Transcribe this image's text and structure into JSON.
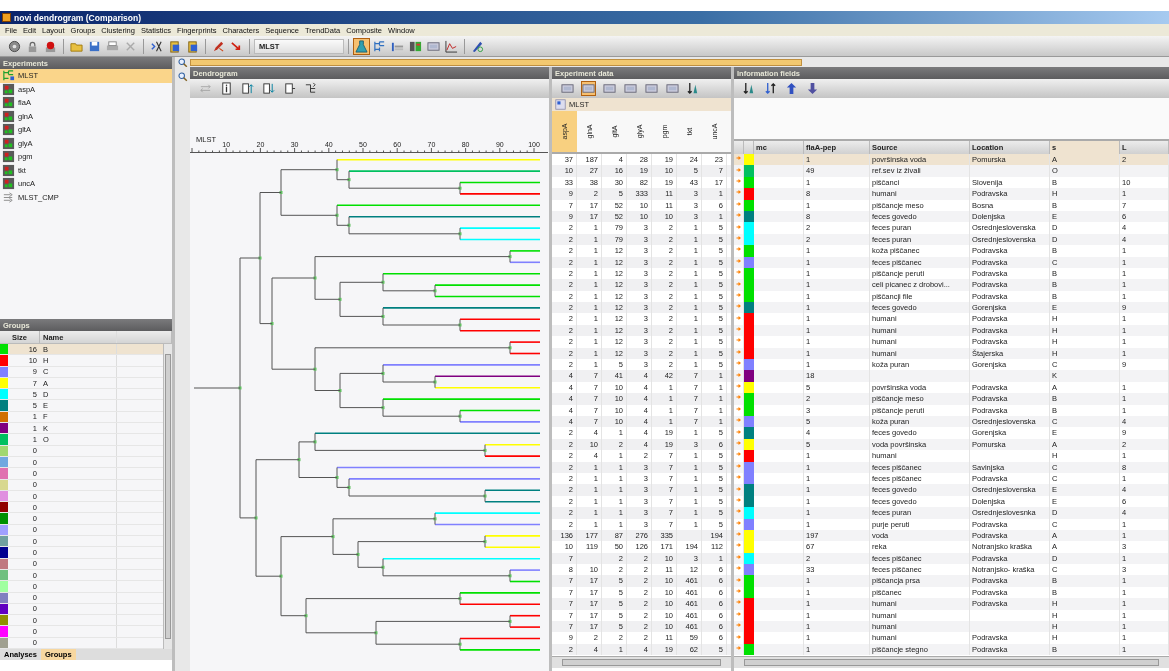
{
  "window": {
    "title": "novi dendrogram (Comparison)"
  },
  "menu": [
    "File",
    "Edit",
    "Layout",
    "Groups",
    "Clustering",
    "Statistics",
    "Fingerprints",
    "Characters",
    "Sequence",
    "TrendData",
    "Composite",
    "Window"
  ],
  "toolbar": {
    "left_groups": [
      [
        {
          "kind": "gear",
          "selected": false
        },
        {
          "kind": "lock",
          "selected": false
        },
        {
          "kind": "marker",
          "selected": false
        }
      ],
      [
        {
          "kind": "folder",
          "selected": false
        },
        {
          "kind": "save",
          "selected": false
        },
        {
          "kind": "printer",
          "selected": false
        },
        {
          "kind": "close",
          "selected": false
        }
      ],
      [
        {
          "kind": "scissors",
          "selected": false
        },
        {
          "kind": "clipboard",
          "selected": false
        },
        {
          "kind": "clipboard",
          "selected": false
        }
      ],
      [
        {
          "kind": "pencil",
          "selected": false
        },
        {
          "kind": "arrow",
          "selected": false
        }
      ]
    ],
    "combo": "MLST",
    "right_groups": [
      [
        {
          "kind": "flask",
          "selected": true
        },
        {
          "kind": "tree",
          "selected": false
        },
        {
          "kind": "bars",
          "selected": false
        },
        {
          "kind": "matrix",
          "selected": false
        },
        {
          "kind": "table",
          "selected": false
        },
        {
          "kind": "plot",
          "selected": false
        }
      ],
      [
        {
          "kind": "compass",
          "selected": false
        }
      ]
    ]
  },
  "experiments": {
    "title": "Experiments",
    "items": [
      {
        "label": "MLST",
        "kind": "cluster",
        "selected": true
      },
      {
        "label": "aspA",
        "kind": "character",
        "selected": false
      },
      {
        "label": "flaA",
        "kind": "character",
        "selected": false
      },
      {
        "label": "glnA",
        "kind": "character",
        "selected": false
      },
      {
        "label": "gltA",
        "kind": "character",
        "selected": false
      },
      {
        "label": "glyA",
        "kind": "character",
        "selected": false
      },
      {
        "label": "pgm",
        "kind": "character",
        "selected": false
      },
      {
        "label": "tkt",
        "kind": "character",
        "selected": false
      },
      {
        "label": "uncA",
        "kind": "character",
        "selected": false
      },
      {
        "label": "MLST_CMP",
        "kind": "composite",
        "selected": false
      }
    ]
  },
  "groups": {
    "title": "Groups",
    "columns": [
      "Size",
      "Name"
    ],
    "rows": [
      {
        "size": "16",
        "name": "B",
        "color": "#00e000",
        "selected": true
      },
      {
        "size": "10",
        "name": "H",
        "color": "#ff0000",
        "selected": false
      },
      {
        "size": "9",
        "name": "C",
        "color": "#8080ff",
        "selected": false
      },
      {
        "size": "7",
        "name": "A",
        "color": "#ffff00",
        "selected": false
      },
      {
        "size": "5",
        "name": "D",
        "color": "#00ffff",
        "selected": false
      },
      {
        "size": "5",
        "name": "E",
        "color": "#008080",
        "selected": false
      },
      {
        "size": "1",
        "name": "F",
        "color": "#d07000",
        "selected": false
      },
      {
        "size": "1",
        "name": "K",
        "color": "#800080",
        "selected": false
      },
      {
        "size": "1",
        "name": "O",
        "color": "#00c060",
        "selected": false
      },
      {
        "size": "0",
        "color": "#a0d870",
        "selected": false
      },
      {
        "size": "0",
        "color": "#70a8e0",
        "selected": false
      },
      {
        "size": "0",
        "color": "#e070b0",
        "selected": false
      },
      {
        "size": "0",
        "color": "#d8d890",
        "selected": false
      },
      {
        "size": "0",
        "color": "#e090e0",
        "selected": false
      },
      {
        "size": "0",
        "color": "#900000",
        "selected": false
      },
      {
        "size": "0",
        "color": "#009000",
        "selected": false
      },
      {
        "size": "0",
        "color": "#a0a0ff",
        "selected": false
      },
      {
        "size": "0",
        "color": "#70a0a0",
        "selected": false
      },
      {
        "size": "0",
        "color": "#000090",
        "selected": false
      },
      {
        "size": "0",
        "color": "#c07880",
        "selected": false
      },
      {
        "size": "0",
        "color": "#70c080",
        "selected": false
      },
      {
        "size": "0",
        "color": "#a0ffa0",
        "selected": false
      },
      {
        "size": "0",
        "color": "#8080c0",
        "selected": false
      },
      {
        "size": "0",
        "color": "#6000c0",
        "selected": false
      },
      {
        "size": "0",
        "color": "#909000",
        "selected": false
      },
      {
        "size": "0",
        "color": "#ff00ff",
        "selected": false
      },
      {
        "size": "0",
        "color": "#a0a090",
        "selected": false
      }
    ]
  },
  "bottom_tabs": [
    {
      "label": "Analyses",
      "selected": false
    },
    {
      "label": "Groups",
      "selected": true
    }
  ],
  "dendrogram": {
    "title": "Dendrogram",
    "toolbar": [
      {
        "kind": "swap",
        "disabled": true
      },
      {
        "kind": "info",
        "disabled": false
      },
      {
        "kind": "doc-up",
        "disabled": false
      },
      {
        "kind": "doc-down",
        "disabled": false
      },
      {
        "kind": "doc",
        "disabled": false
      },
      {
        "kind": "branch",
        "disabled": false
      }
    ],
    "axis_label": "MLST",
    "ticks": [
      "10",
      "20",
      "30",
      "40",
      "50",
      "60",
      "70",
      "80",
      "90",
      "100"
    ]
  },
  "experiment_data": {
    "title": "Experiment data",
    "toolbar": [
      {
        "kind": "table",
        "selected": false
      },
      {
        "kind": "table",
        "selected": true
      },
      {
        "kind": "table",
        "selected": false
      },
      {
        "kind": "table",
        "selected": false
      },
      {
        "kind": "table",
        "selected": false
      },
      {
        "kind": "table",
        "selected": false
      },
      {
        "kind": "sort",
        "selected": false
      }
    ],
    "experiment": "MLST",
    "columns": [
      {
        "label": "aspA",
        "selected": true
      },
      {
        "label": "glnA",
        "selected": false
      },
      {
        "label": "gltA",
        "selected": false
      },
      {
        "label": "glyA",
        "selected": false
      },
      {
        "label": "pgm",
        "selected": false
      },
      {
        "label": "tkt",
        "selected": false
      },
      {
        "label": "uncA",
        "selected": false
      }
    ],
    "rows": [
      [
        "37",
        "187",
        "4",
        "28",
        "19",
        "24",
        "23"
      ],
      [
        "10",
        "27",
        "16",
        "19",
        "10",
        "5",
        "7"
      ],
      [
        "33",
        "38",
        "30",
        "82",
        "19",
        "43",
        "17"
      ],
      [
        "9",
        "2",
        "5",
        "333",
        "11",
        "3",
        "1"
      ],
      [
        "7",
        "17",
        "52",
        "10",
        "11",
        "3",
        "6"
      ],
      [
        "9",
        "17",
        "52",
        "10",
        "10",
        "3",
        "1"
      ],
      [
        "2",
        "1",
        "79",
        "3",
        "2",
        "1",
        "5"
      ],
      [
        "2",
        "1",
        "79",
        "3",
        "2",
        "1",
        "5"
      ],
      [
        "2",
        "1",
        "12",
        "3",
        "2",
        "1",
        "5"
      ],
      [
        "2",
        "1",
        "12",
        "3",
        "2",
        "1",
        "5"
      ],
      [
        "2",
        "1",
        "12",
        "3",
        "2",
        "1",
        "5"
      ],
      [
        "2",
        "1",
        "12",
        "3",
        "2",
        "1",
        "5"
      ],
      [
        "2",
        "1",
        "12",
        "3",
        "2",
        "1",
        "5"
      ],
      [
        "2",
        "1",
        "12",
        "3",
        "2",
        "1",
        "5"
      ],
      [
        "2",
        "1",
        "12",
        "3",
        "2",
        "1",
        "5"
      ],
      [
        "2",
        "1",
        "12",
        "3",
        "2",
        "1",
        "5"
      ],
      [
        "2",
        "1",
        "12",
        "3",
        "2",
        "1",
        "5"
      ],
      [
        "2",
        "1",
        "12",
        "3",
        "2",
        "1",
        "5"
      ],
      [
        "2",
        "1",
        "5",
        "3",
        "2",
        "1",
        "5"
      ],
      [
        "4",
        "7",
        "41",
        "4",
        "42",
        "7",
        "1"
      ],
      [
        "4",
        "7",
        "10",
        "4",
        "1",
        "7",
        "1"
      ],
      [
        "4",
        "7",
        "10",
        "4",
        "1",
        "7",
        "1"
      ],
      [
        "4",
        "7",
        "10",
        "4",
        "1",
        "7",
        "1"
      ],
      [
        "4",
        "7",
        "10",
        "4",
        "1",
        "7",
        "1"
      ],
      [
        "2",
        "4",
        "1",
        "4",
        "19",
        "1",
        "5"
      ],
      [
        "2",
        "10",
        "2",
        "4",
        "19",
        "3",
        "6"
      ],
      [
        "2",
        "4",
        "1",
        "2",
        "7",
        "1",
        "5"
      ],
      [
        "2",
        "1",
        "1",
        "3",
        "7",
        "1",
        "5"
      ],
      [
        "2",
        "1",
        "1",
        "3",
        "7",
        "1",
        "5"
      ],
      [
        "2",
        "1",
        "1",
        "3",
        "7",
        "1",
        "5"
      ],
      [
        "2",
        "1",
        "1",
        "3",
        "7",
        "1",
        "5"
      ],
      [
        "2",
        "1",
        "1",
        "3",
        "7",
        "1",
        "5"
      ],
      [
        "2",
        "1",
        "1",
        "3",
        "7",
        "1",
        "5"
      ],
      [
        "136",
        "177",
        "87",
        "276",
        "335",
        null,
        "194"
      ],
      [
        "10",
        "119",
        "50",
        "126",
        "171",
        "194",
        "112"
      ],
      [
        "7",
        null,
        "2",
        "2",
        "10",
        "3",
        "1"
      ],
      [
        "8",
        "10",
        "2",
        "2",
        "11",
        "12",
        "6"
      ],
      [
        "7",
        "17",
        "5",
        "2",
        "10",
        "461",
        "6"
      ],
      [
        "7",
        "17",
        "5",
        "2",
        "10",
        "461",
        "6"
      ],
      [
        "7",
        "17",
        "5",
        "2",
        "10",
        "461",
        "6"
      ],
      [
        "7",
        "17",
        "5",
        "2",
        "10",
        "461",
        "6"
      ],
      [
        "7",
        "17",
        "5",
        "2",
        "10",
        "461",
        "6"
      ],
      [
        "9",
        "2",
        "2",
        "2",
        "11",
        "59",
        "6"
      ],
      [
        "2",
        "4",
        "1",
        "4",
        "19",
        "62",
        "5"
      ]
    ]
  },
  "information_fields": {
    "title": "Information fields",
    "toolbar": [
      {
        "kind": "sort"
      },
      {
        "kind": "sort2"
      },
      {
        "kind": "up"
      },
      {
        "kind": "down"
      }
    ],
    "columns": [
      {
        "label": "mc",
        "selected": false
      },
      {
        "label": "flaA-pep",
        "selected": false
      },
      {
        "label": "Source",
        "selected": false
      },
      {
        "label": "Location",
        "selected": false
      },
      {
        "label": "s",
        "selected": true
      },
      {
        "label": "L",
        "selected": false
      }
    ],
    "rows": [
      {
        "cells": [
          null,
          "1",
          "površinska voda",
          "Pomurska",
          "A",
          "2"
        ],
        "color": "#ffff00",
        "selected": true
      },
      {
        "cells": [
          null,
          "49",
          "ref.sev iz živali",
          null,
          "O",
          null
        ],
        "color": "#00c060",
        "selected": false
      },
      {
        "cells": [
          null,
          "1",
          "piščanci",
          "Slovenija",
          "B",
          "10"
        ],
        "color": "#00e000",
        "selected": false
      },
      {
        "cells": [
          null,
          "8",
          "humani",
          "Podravska",
          "H",
          "1"
        ],
        "color": "#ff0000",
        "selected": false
      },
      {
        "cells": [
          null,
          "1",
          "piščancje meso",
          "Bosna",
          "B",
          "7"
        ],
        "color": "#00e000",
        "selected": false
      },
      {
        "cells": [
          null,
          "8",
          "feces govedo",
          "Dolenjska",
          "E",
          "6"
        ],
        "color": "#008080",
        "selected": false
      },
      {
        "cells": [
          null,
          "2",
          "feces puran",
          "Osrednjeslovenska",
          "D",
          "4"
        ],
        "color": "#00ffff",
        "selected": false
      },
      {
        "cells": [
          null,
          "2",
          "feces puran",
          "Osrednjeslovenska",
          "D",
          "4"
        ],
        "color": "#00ffff",
        "selected": false
      },
      {
        "cells": [
          null,
          "1",
          "koža piščanec",
          "Podravska",
          "B",
          "1"
        ],
        "color": "#00e000",
        "selected": false
      },
      {
        "cells": [
          null,
          "1",
          "feces piščanec",
          "Podravska",
          "C",
          "1"
        ],
        "color": "#8080ff",
        "selected": false
      },
      {
        "cells": [
          null,
          "1",
          "piščancje peruti",
          "Podravska",
          "B",
          "1"
        ],
        "color": "#00e000",
        "selected": false
      },
      {
        "cells": [
          null,
          "1",
          "celi picanec z drobovi...",
          "Podravska",
          "B",
          "1"
        ],
        "color": "#00e000",
        "selected": false
      },
      {
        "cells": [
          null,
          "1",
          "piščancji file",
          "Podravska",
          "B",
          "1"
        ],
        "color": "#00e000",
        "selected": false
      },
      {
        "cells": [
          null,
          "1",
          "feces govedo",
          "Gorenjska",
          "E",
          "9"
        ],
        "color": "#008080",
        "selected": false
      },
      {
        "cells": [
          null,
          "1",
          "humani",
          "Podravska",
          "H",
          "1"
        ],
        "color": "#ff0000",
        "selected": false
      },
      {
        "cells": [
          null,
          "1",
          "humani",
          "Podravska",
          "H",
          "1"
        ],
        "color": "#ff0000",
        "selected": false
      },
      {
        "cells": [
          null,
          "1",
          "humani",
          "Podravska",
          "H",
          "1"
        ],
        "color": "#ff0000",
        "selected": false
      },
      {
        "cells": [
          null,
          "1",
          "humani",
          "Štajerska",
          "H",
          "1"
        ],
        "color": "#ff0000",
        "selected": false
      },
      {
        "cells": [
          null,
          "1",
          "koža puran",
          "Gorenjska",
          "C",
          "9"
        ],
        "color": "#8080ff",
        "selected": false
      },
      {
        "cells": [
          null,
          "18",
          null,
          null,
          "K",
          null
        ],
        "color": "#800080",
        "selected": false
      },
      {
        "cells": [
          null,
          "5",
          "površinska voda",
          "Podravska",
          "A",
          "1"
        ],
        "color": "#ffff00",
        "selected": false
      },
      {
        "cells": [
          null,
          "2",
          "piščancje meso",
          "Podravska",
          "B",
          "1"
        ],
        "color": "#00e000",
        "selected": false
      },
      {
        "cells": [
          null,
          "3",
          "piščancje peruti",
          "Podravska",
          "B",
          "1"
        ],
        "color": "#00e000",
        "selected": false
      },
      {
        "cells": [
          null,
          "5",
          "koža puran",
          "Osrednjeslovenska",
          "C",
          "4"
        ],
        "color": "#8080ff",
        "selected": false
      },
      {
        "cells": [
          null,
          "4",
          "feces govedo",
          "Gorenjska",
          "E",
          "9"
        ],
        "color": "#008080",
        "selected": false
      },
      {
        "cells": [
          null,
          "5",
          "voda površinska",
          "Pomurska",
          "A",
          "2"
        ],
        "color": "#ffff00",
        "selected": false
      },
      {
        "cells": [
          null,
          "1",
          "humani",
          null,
          "H",
          "1"
        ],
        "color": "#ff0000",
        "selected": false
      },
      {
        "cells": [
          null,
          "1",
          "feces piščanec",
          "Savinjska",
          "C",
          "8"
        ],
        "color": "#8080ff",
        "selected": false
      },
      {
        "cells": [
          null,
          "1",
          "feces piščanec",
          "Podravska",
          "C",
          "1"
        ],
        "color": "#8080ff",
        "selected": false
      },
      {
        "cells": [
          null,
          "1",
          "feces govedo",
          "Osrednjeslovenska",
          "E",
          "4"
        ],
        "color": "#008080",
        "selected": false
      },
      {
        "cells": [
          null,
          "1",
          "feces govedo",
          "Dolenjska",
          "E",
          "6"
        ],
        "color": "#008080",
        "selected": false
      },
      {
        "cells": [
          null,
          "1",
          "feces puran",
          "Osrednjeslovesnka",
          "D",
          "4"
        ],
        "color": "#00ffff",
        "selected": false
      },
      {
        "cells": [
          null,
          "1",
          "purje peruti",
          "Podravska",
          "C",
          "1"
        ],
        "color": "#8080ff",
        "selected": false
      },
      {
        "cells": [
          null,
          "197",
          "voda",
          "Podravska",
          "A",
          "1"
        ],
        "color": "#ffff00",
        "selected": false
      },
      {
        "cells": [
          null,
          "67",
          "reka",
          "Notranjsko kraška",
          "A",
          "3"
        ],
        "color": "#ffff00",
        "selected": false
      },
      {
        "cells": [
          null,
          "2",
          "feces piščanec",
          "Podravska",
          "D",
          "1"
        ],
        "color": "#00ffff",
        "selected": false
      },
      {
        "cells": [
          null,
          "33",
          "feces piščanec",
          "Notranjsko- kraška",
          "C",
          "3"
        ],
        "color": "#8080ff",
        "selected": false
      },
      {
        "cells": [
          null,
          "1",
          "piščancja prsa",
          "Podravska",
          "B",
          "1"
        ],
        "color": "#00e000",
        "selected": false
      },
      {
        "cells": [
          null,
          "1",
          "piščanec",
          "Podravska",
          "B",
          "1"
        ],
        "color": "#00e000",
        "selected": false
      },
      {
        "cells": [
          null,
          "1",
          "humani",
          "Podravska",
          "H",
          "1"
        ],
        "color": "#ff0000",
        "selected": false
      },
      {
        "cells": [
          null,
          "1",
          "humani",
          null,
          "H",
          "1"
        ],
        "color": "#ff0000",
        "selected": false
      },
      {
        "cells": [
          null,
          "1",
          "humani",
          null,
          "H",
          "1"
        ],
        "color": "#ff0000",
        "selected": false
      },
      {
        "cells": [
          null,
          "1",
          "humani",
          "Podravska",
          "H",
          "1"
        ],
        "color": "#ff0000",
        "selected": false
      },
      {
        "cells": [
          null,
          "1",
          "piščancje stegno",
          "Podravska",
          "B",
          "1"
        ],
        "color": "#00e000",
        "selected": false
      }
    ]
  }
}
